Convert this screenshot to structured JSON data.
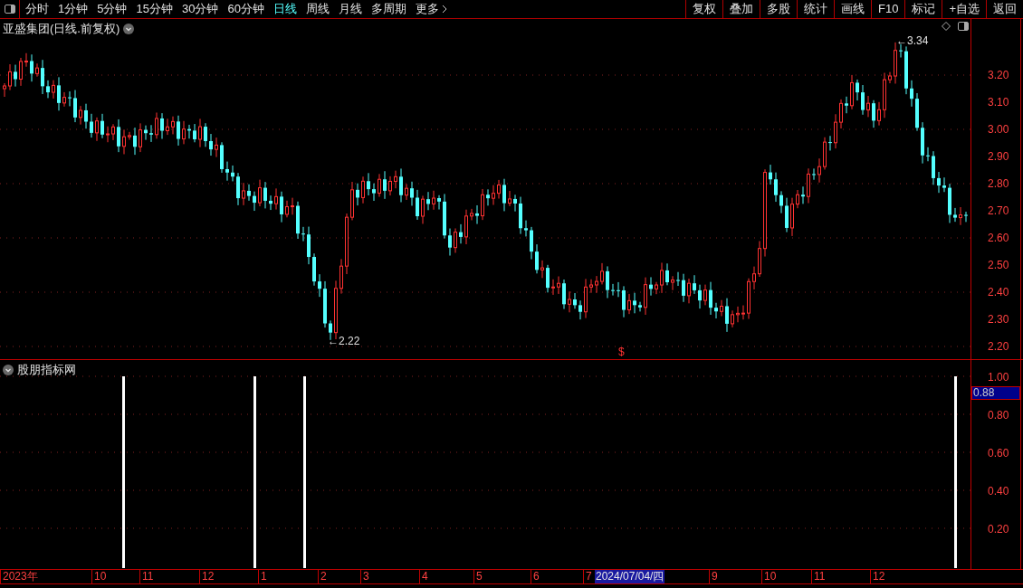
{
  "toolbar": {
    "tabs": [
      {
        "label": "分时",
        "selected": false
      },
      {
        "label": "1分钟",
        "selected": false
      },
      {
        "label": "5分钟",
        "selected": false
      },
      {
        "label": "15分钟",
        "selected": false
      },
      {
        "label": "30分钟",
        "selected": false
      },
      {
        "label": "60分钟",
        "selected": false
      },
      {
        "label": "日线",
        "selected": true
      },
      {
        "label": "周线",
        "selected": false
      },
      {
        "label": "月线",
        "selected": false
      },
      {
        "label": "多周期",
        "selected": false
      },
      {
        "label": "更多",
        "selected": false
      }
    ],
    "buttons": [
      "复权",
      "叠加",
      "多股",
      "统计",
      "画线",
      "F10",
      "标记",
      "+自选",
      "返回"
    ]
  },
  "price_chart": {
    "title": "亚盛集团(日线.前复权)",
    "y_labels": [
      "3.20",
      "3.10",
      "3.00",
      "2.90",
      "2.80",
      "2.70",
      "2.60",
      "2.50",
      "2.40",
      "2.30",
      "2.20"
    ],
    "low_marker": "←2.22",
    "high_marker": "←3.34",
    "marker": "$"
  },
  "indicator": {
    "title": "股朋指标网",
    "y_labels": [
      "1.00",
      "0.80",
      "0.60",
      "0.40",
      "0.20"
    ],
    "reading": "0.88"
  },
  "date_axis": {
    "labels": [
      "2023年",
      "10",
      "11",
      "12",
      "1",
      "2",
      "3",
      "4",
      "5",
      "6",
      "7",
      "9",
      "10",
      "11",
      "12"
    ],
    "cursor_date": "2024/07/04/四"
  }
}
